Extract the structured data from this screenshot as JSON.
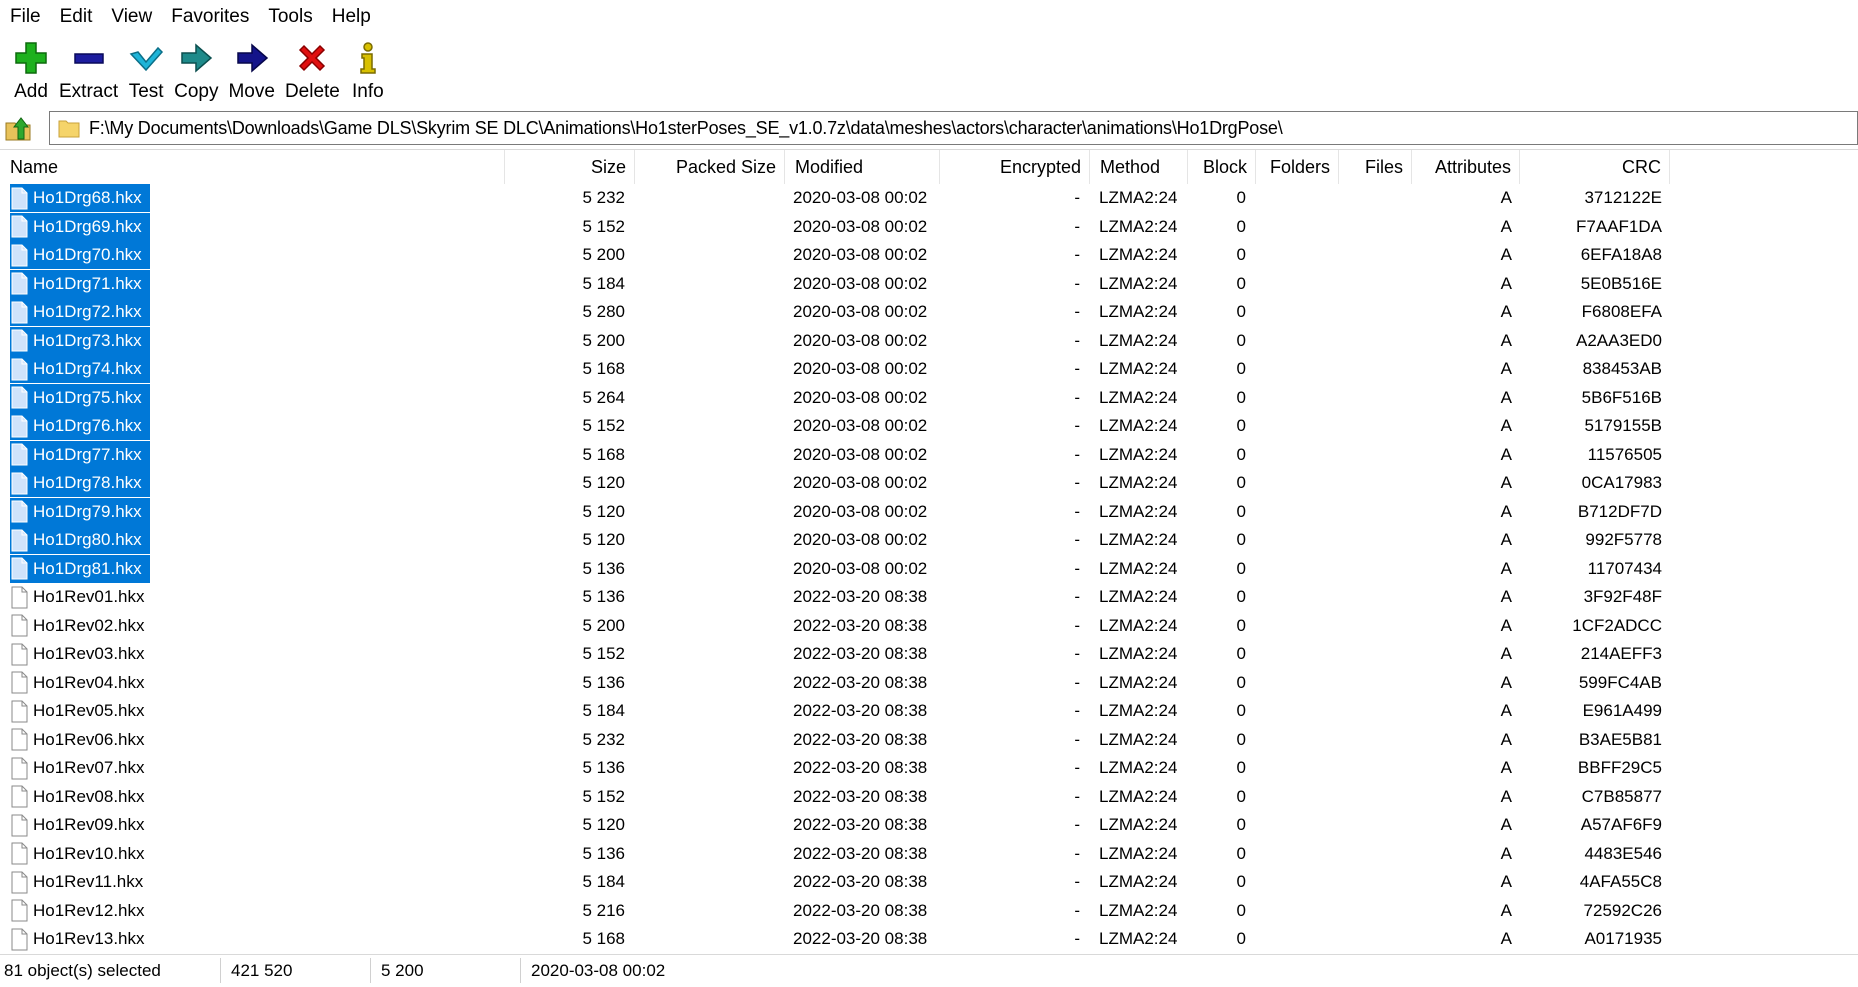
{
  "menu": [
    "File",
    "Edit",
    "View",
    "Favorites",
    "Tools",
    "Help"
  ],
  "toolbar": [
    {
      "label": "Add",
      "icon": "plus-icon"
    },
    {
      "label": "Extract",
      "icon": "minus-icon"
    },
    {
      "label": "Test",
      "icon": "check-icon"
    },
    {
      "label": "Copy",
      "icon": "copy-arrow-icon"
    },
    {
      "label": "Move",
      "icon": "move-arrow-icon"
    },
    {
      "label": "Delete",
      "icon": "x-icon"
    },
    {
      "label": "Info",
      "icon": "info-icon"
    }
  ],
  "address": {
    "path": "F:\\My Documents\\Downloads\\Game DLS\\Skyrim SE DLC\\Animations\\Ho1sterPoses_SE_v1.0.7z\\data\\meshes\\actors\\character\\animations\\Ho1DrgPose\\"
  },
  "columns": [
    "Name",
    "Size",
    "Packed Size",
    "Modified",
    "Encrypted",
    "Method",
    "Block",
    "Folders",
    "Files",
    "Attributes",
    "CRC"
  ],
  "rows": [
    {
      "name": "Ho1Drg68.hkx",
      "size": "5 232",
      "modified": "2020-03-08 00:02",
      "encrypted": "-",
      "method": "LZMA2:24",
      "block": "0",
      "attributes": "A",
      "crc": "3712122E",
      "selected": true
    },
    {
      "name": "Ho1Drg69.hkx",
      "size": "5 152",
      "modified": "2020-03-08 00:02",
      "encrypted": "-",
      "method": "LZMA2:24",
      "block": "0",
      "attributes": "A",
      "crc": "F7AAF1DA",
      "selected": true
    },
    {
      "name": "Ho1Drg70.hkx",
      "size": "5 200",
      "modified": "2020-03-08 00:02",
      "encrypted": "-",
      "method": "LZMA2:24",
      "block": "0",
      "attributes": "A",
      "crc": "6EFA18A8",
      "selected": true
    },
    {
      "name": "Ho1Drg71.hkx",
      "size": "5 184",
      "modified": "2020-03-08 00:02",
      "encrypted": "-",
      "method": "LZMA2:24",
      "block": "0",
      "attributes": "A",
      "crc": "5E0B516E",
      "selected": true
    },
    {
      "name": "Ho1Drg72.hkx",
      "size": "5 280",
      "modified": "2020-03-08 00:02",
      "encrypted": "-",
      "method": "LZMA2:24",
      "block": "0",
      "attributes": "A",
      "crc": "F6808EFA",
      "selected": true
    },
    {
      "name": "Ho1Drg73.hkx",
      "size": "5 200",
      "modified": "2020-03-08 00:02",
      "encrypted": "-",
      "method": "LZMA2:24",
      "block": "0",
      "attributes": "A",
      "crc": "A2AA3ED0",
      "selected": true
    },
    {
      "name": "Ho1Drg74.hkx",
      "size": "5 168",
      "modified": "2020-03-08 00:02",
      "encrypted": "-",
      "method": "LZMA2:24",
      "block": "0",
      "attributes": "A",
      "crc": "838453AB",
      "selected": true
    },
    {
      "name": "Ho1Drg75.hkx",
      "size": "5 264",
      "modified": "2020-03-08 00:02",
      "encrypted": "-",
      "method": "LZMA2:24",
      "block": "0",
      "attributes": "A",
      "crc": "5B6F516B",
      "selected": true
    },
    {
      "name": "Ho1Drg76.hkx",
      "size": "5 152",
      "modified": "2020-03-08 00:02",
      "encrypted": "-",
      "method": "LZMA2:24",
      "block": "0",
      "attributes": "A",
      "crc": "5179155B",
      "selected": true
    },
    {
      "name": "Ho1Drg77.hkx",
      "size": "5 168",
      "modified": "2020-03-08 00:02",
      "encrypted": "-",
      "method": "LZMA2:24",
      "block": "0",
      "attributes": "A",
      "crc": "11576505",
      "selected": true
    },
    {
      "name": "Ho1Drg78.hkx",
      "size": "5 120",
      "modified": "2020-03-08 00:02",
      "encrypted": "-",
      "method": "LZMA2:24",
      "block": "0",
      "attributes": "A",
      "crc": "0CA17983",
      "selected": true
    },
    {
      "name": "Ho1Drg79.hkx",
      "size": "5 120",
      "modified": "2020-03-08 00:02",
      "encrypted": "-",
      "method": "LZMA2:24",
      "block": "0",
      "attributes": "A",
      "crc": "B712DF7D",
      "selected": true
    },
    {
      "name": "Ho1Drg80.hkx",
      "size": "5 120",
      "modified": "2020-03-08 00:02",
      "encrypted": "-",
      "method": "LZMA2:24",
      "block": "0",
      "attributes": "A",
      "crc": "992F5778",
      "selected": true
    },
    {
      "name": "Ho1Drg81.hkx",
      "size": "5 136",
      "modified": "2020-03-08 00:02",
      "encrypted": "-",
      "method": "LZMA2:24",
      "block": "0",
      "attributes": "A",
      "crc": "11707434",
      "selected": true
    },
    {
      "name": "Ho1Rev01.hkx",
      "size": "5 136",
      "modified": "2022-03-20 08:38",
      "encrypted": "-",
      "method": "LZMA2:24",
      "block": "0",
      "attributes": "A",
      "crc": "3F92F48F",
      "selected": false
    },
    {
      "name": "Ho1Rev02.hkx",
      "size": "5 200",
      "modified": "2022-03-20 08:38",
      "encrypted": "-",
      "method": "LZMA2:24",
      "block": "0",
      "attributes": "A",
      "crc": "1CF2ADCC",
      "selected": false
    },
    {
      "name": "Ho1Rev03.hkx",
      "size": "5 152",
      "modified": "2022-03-20 08:38",
      "encrypted": "-",
      "method": "LZMA2:24",
      "block": "0",
      "attributes": "A",
      "crc": "214AEFF3",
      "selected": false
    },
    {
      "name": "Ho1Rev04.hkx",
      "size": "5 136",
      "modified": "2022-03-20 08:38",
      "encrypted": "-",
      "method": "LZMA2:24",
      "block": "0",
      "attributes": "A",
      "crc": "599FC4AB",
      "selected": false
    },
    {
      "name": "Ho1Rev05.hkx",
      "size": "5 184",
      "modified": "2022-03-20 08:38",
      "encrypted": "-",
      "method": "LZMA2:24",
      "block": "0",
      "attributes": "A",
      "crc": "E961A499",
      "selected": false
    },
    {
      "name": "Ho1Rev06.hkx",
      "size": "5 232",
      "modified": "2022-03-20 08:38",
      "encrypted": "-",
      "method": "LZMA2:24",
      "block": "0",
      "attributes": "A",
      "crc": "B3AE5B81",
      "selected": false
    },
    {
      "name": "Ho1Rev07.hkx",
      "size": "5 136",
      "modified": "2022-03-20 08:38",
      "encrypted": "-",
      "method": "LZMA2:24",
      "block": "0",
      "attributes": "A",
      "crc": "BBFF29C5",
      "selected": false
    },
    {
      "name": "Ho1Rev08.hkx",
      "size": "5 152",
      "modified": "2022-03-20 08:38",
      "encrypted": "-",
      "method": "LZMA2:24",
      "block": "0",
      "attributes": "A",
      "crc": "C7B85877",
      "selected": false
    },
    {
      "name": "Ho1Rev09.hkx",
      "size": "5 120",
      "modified": "2022-03-20 08:38",
      "encrypted": "-",
      "method": "LZMA2:24",
      "block": "0",
      "attributes": "A",
      "crc": "A57AF6F9",
      "selected": false
    },
    {
      "name": "Ho1Rev10.hkx",
      "size": "5 136",
      "modified": "2022-03-20 08:38",
      "encrypted": "-",
      "method": "LZMA2:24",
      "block": "0",
      "attributes": "A",
      "crc": "4483E546",
      "selected": false
    },
    {
      "name": "Ho1Rev11.hkx",
      "size": "5 184",
      "modified": "2022-03-20 08:38",
      "encrypted": "-",
      "method": "LZMA2:24",
      "block": "0",
      "attributes": "A",
      "crc": "4AFA55C8",
      "selected": false
    },
    {
      "name": "Ho1Rev12.hkx",
      "size": "5 216",
      "modified": "2022-03-20 08:38",
      "encrypted": "-",
      "method": "LZMA2:24",
      "block": "0",
      "attributes": "A",
      "crc": "72592C26",
      "selected": false
    },
    {
      "name": "Ho1Rev13.hkx",
      "size": "5 168",
      "modified": "2022-03-20 08:38",
      "encrypted": "-",
      "method": "LZMA2:24",
      "block": "0",
      "attributes": "A",
      "crc": "A0171935",
      "selected": false
    }
  ],
  "status": {
    "selected": "81 object(s) selected",
    "total_size": "421 520",
    "item_size": "5 200",
    "modified": "2020-03-08 00:02"
  },
  "colors": {
    "selection": "#0078d7",
    "add": "#1db11d",
    "extract": "#1d1d9f",
    "test": "#1eb4d8",
    "copy": "#1e8a8a",
    "move": "#14148a",
    "delete": "#e01010",
    "info": "#d8c000"
  }
}
